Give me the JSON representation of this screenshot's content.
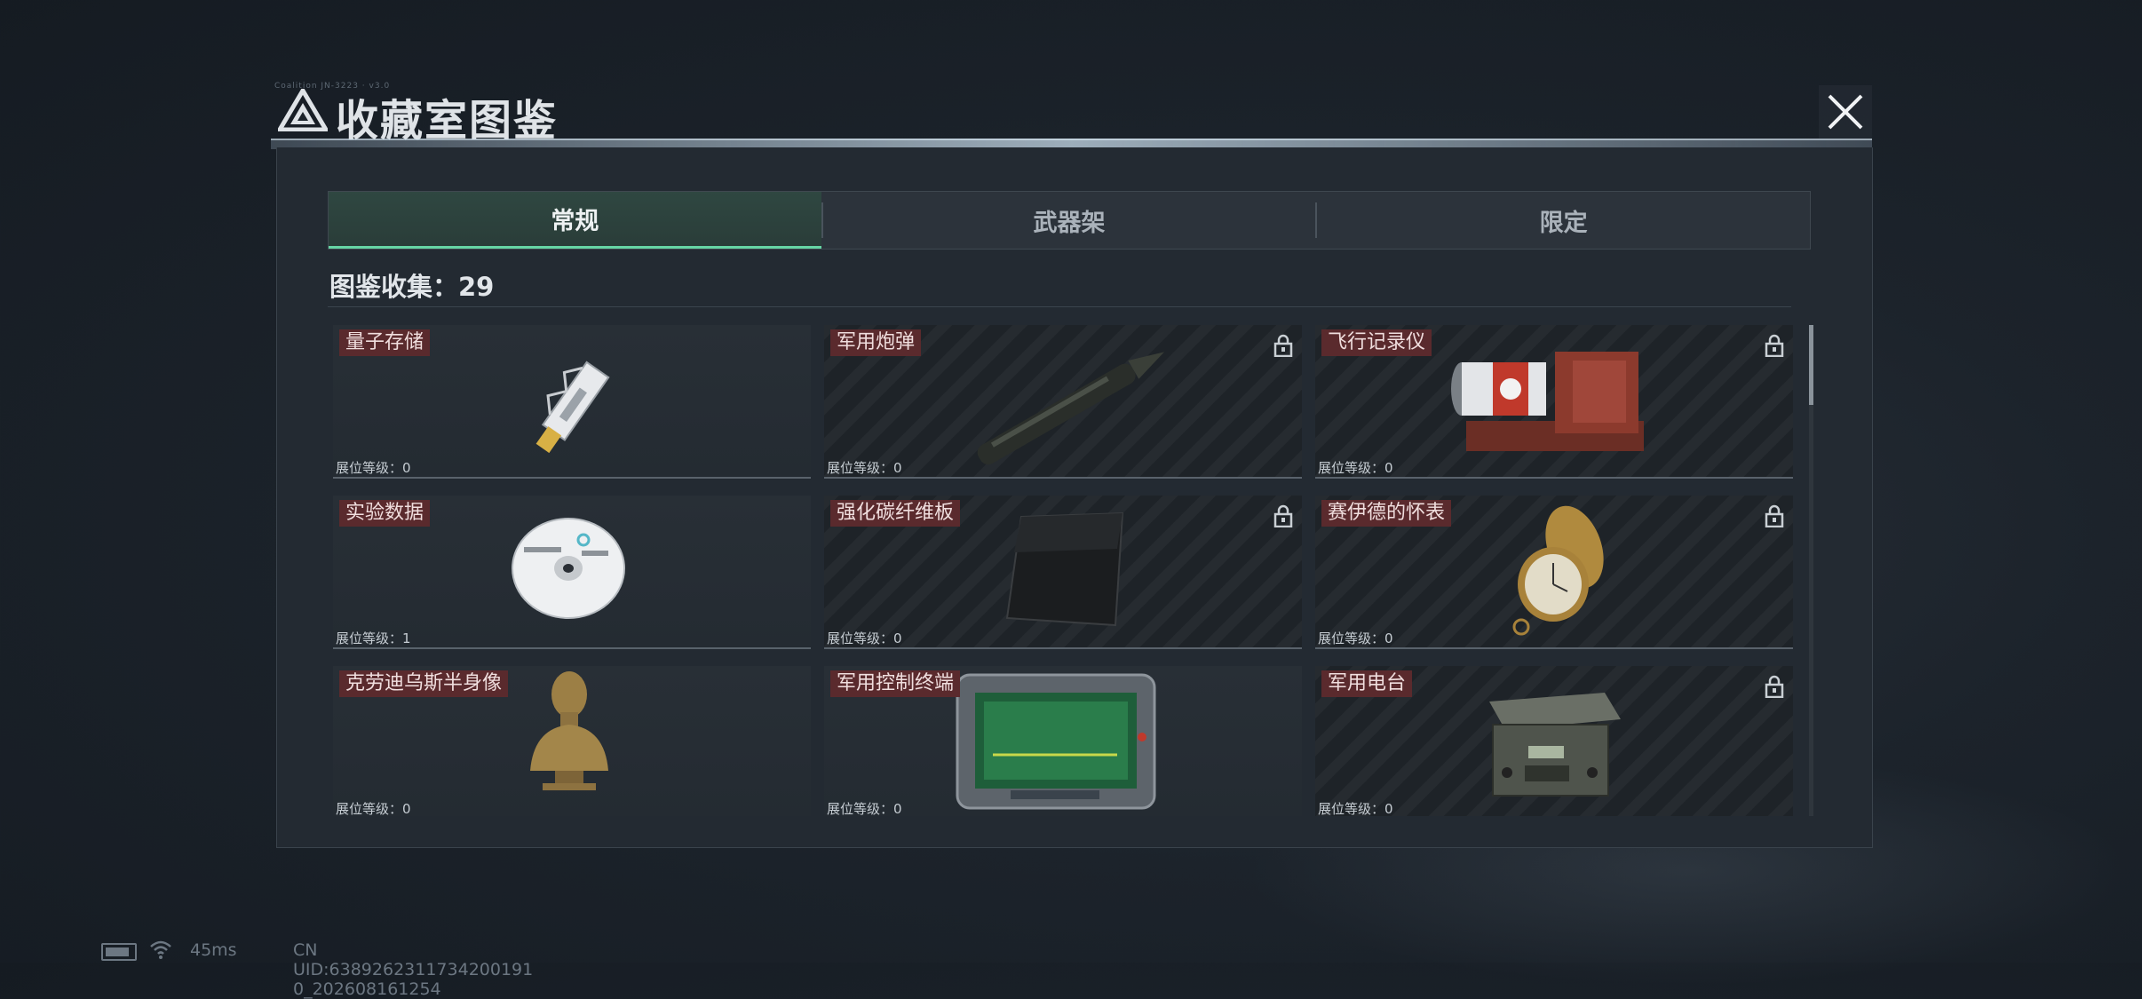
{
  "header": {
    "small_text": "Coalition JN-3223 · v3.0",
    "title": "收藏室图鉴",
    "close_icon": "close-icon"
  },
  "tabs": [
    {
      "label": "常规",
      "active": true
    },
    {
      "label": "武器架",
      "active": false
    },
    {
      "label": "限定",
      "active": false
    }
  ],
  "collection": {
    "label": "图鉴收集：29"
  },
  "items": [
    {
      "name": "量子存储",
      "level": "展位等级：0",
      "locked": false,
      "icon": "usb-drive-icon"
    },
    {
      "name": "军用炮弹",
      "level": "展位等级：0",
      "locked": true,
      "icon": "artillery-shell-icon"
    },
    {
      "name": "飞行记录仪",
      "level": "展位等级：0",
      "locked": true,
      "icon": "flight-recorder-icon"
    },
    {
      "name": "实验数据",
      "level": "展位等级：1",
      "locked": false,
      "icon": "disc-icon"
    },
    {
      "name": "强化碳纤维板",
      "level": "展位等级：0",
      "locked": true,
      "icon": "carbon-plate-icon"
    },
    {
      "name": "赛伊德的怀表",
      "level": "展位等级：0",
      "locked": true,
      "icon": "pocket-watch-icon"
    },
    {
      "name": "克劳迪乌斯半身像",
      "level": "展位等级：0",
      "locked": false,
      "icon": "bust-statue-icon"
    },
    {
      "name": "军用控制终端",
      "level": "展位等级：0",
      "locked": false,
      "icon": "control-terminal-icon"
    },
    {
      "name": "军用电台",
      "level": "展位等级：0",
      "locked": true,
      "icon": "military-radio-icon"
    }
  ],
  "status_bar": {
    "ping": "45ms",
    "uid": "CN UID:6389262311734200191 0_202608161254"
  },
  "colors": {
    "accent": "#66d5a5",
    "name_tag": "#5a2a2d",
    "panel": "#232a32"
  }
}
